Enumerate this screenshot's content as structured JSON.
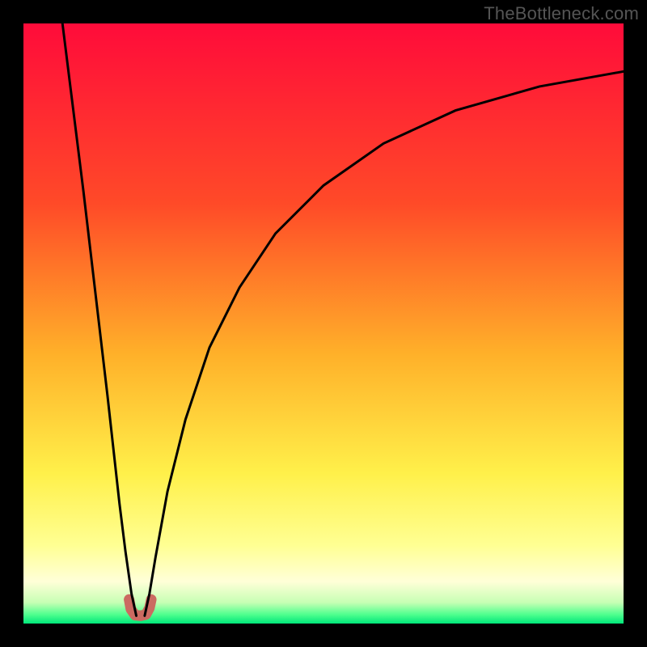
{
  "watermark": "TheBottleneck.com",
  "chart_data": {
    "type": "line",
    "title": "",
    "xlabel": "",
    "ylabel": "",
    "xlim": [
      0,
      100
    ],
    "ylim": [
      0,
      100
    ],
    "grid": false,
    "legend": false,
    "background_gradient": {
      "stops": [
        {
          "offset": 0.0,
          "color": "#ff0b3a"
        },
        {
          "offset": 0.3,
          "color": "#ff4a28"
        },
        {
          "offset": 0.55,
          "color": "#ffb029"
        },
        {
          "offset": 0.75,
          "color": "#fff04a"
        },
        {
          "offset": 0.87,
          "color": "#ffff93"
        },
        {
          "offset": 0.93,
          "color": "#ffffd8"
        },
        {
          "offset": 0.965,
          "color": "#c7ffb4"
        },
        {
          "offset": 0.985,
          "color": "#4fff8e"
        },
        {
          "offset": 1.0,
          "color": "#00e67a"
        }
      ]
    },
    "minimum_x": 19,
    "series": [
      {
        "name": "left-branch",
        "x": [
          6.5,
          8,
          10,
          12,
          14,
          16,
          17,
          18,
          18.8
        ],
        "y": [
          100,
          88,
          72,
          55,
          38,
          20,
          12,
          5,
          1.3
        ]
      },
      {
        "name": "right-branch",
        "x": [
          20.2,
          21,
          22,
          24,
          27,
          31,
          36,
          42,
          50,
          60,
          72,
          86,
          100
        ],
        "y": [
          1.3,
          5,
          11,
          22,
          34,
          46,
          56,
          65,
          73,
          80,
          85.5,
          89.5,
          92
        ]
      }
    ],
    "valley_marker": {
      "color": "#cb6a61",
      "stroke_width": 13,
      "path_xy": [
        [
          17.6,
          4.0
        ],
        [
          17.9,
          2.4
        ],
        [
          18.6,
          1.4
        ],
        [
          19.5,
          1.3
        ],
        [
          20.4,
          1.5
        ],
        [
          21.0,
          2.6
        ],
        [
          21.3,
          4.0
        ]
      ]
    },
    "curve_style": {
      "color": "#000000",
      "stroke_width": 3
    }
  }
}
